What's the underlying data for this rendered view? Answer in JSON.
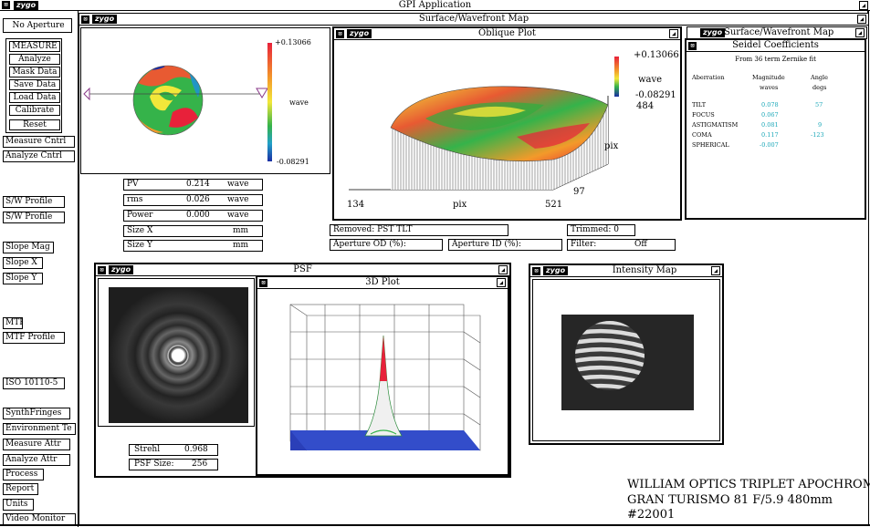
{
  "app": {
    "title": "GPI Application",
    "logo": "zygo"
  },
  "sidebar": {
    "aperture": "No Aperture",
    "menu": [
      "MEASURE",
      "Analyze",
      "Mask Data",
      "Save Data",
      "Load Data",
      "Calibrate",
      "Reset"
    ],
    "buttons": [
      "Measure Cntrl",
      "Analyze Cntrl",
      "S/W Profile",
      "S/W Profile",
      "Slope Mag",
      "Slope X",
      "Slope Y",
      "MTF",
      "MTF Profile",
      "ISO 10110-5",
      "SynthFringes",
      "Environment Te",
      "Measure Attr",
      "Analyze Attr",
      "Process",
      "Report",
      "Units",
      "Video Monitor"
    ]
  },
  "surface_window": {
    "title": "Surface/Wavefront Map",
    "scale_max": "+0.13066",
    "scale_unit": "wave",
    "scale_min": "-0.08291",
    "stats": [
      {
        "label": "PV",
        "value": "0.214",
        "unit": "wave"
      },
      {
        "label": "rms",
        "value": "0.026",
        "unit": "wave"
      },
      {
        "label": "Power",
        "value": "0.000",
        "unit": "wave"
      },
      {
        "label": "Size X",
        "value": "",
        "unit": "mm"
      },
      {
        "label": "Size Y",
        "value": "",
        "unit": "mm"
      }
    ],
    "removed": "Removed: PST TLT",
    "trimmed": "Trimmed:  0",
    "aperture_od": "Aperture OD (%):",
    "aperture_id": "Aperture ID (%):",
    "filter": "Filter:",
    "filter_value": "Off"
  },
  "oblique_plot": {
    "title": "Oblique Plot",
    "scale_max": "+0.13066",
    "scale_unit": "wave",
    "scale_min": "-0.08291",
    "y_max": "484",
    "y_label": "pix",
    "y_min": "97",
    "x_min": "134",
    "x_label": "pix",
    "x_max": "521"
  },
  "seidel": {
    "title_back": "Surface/Wavefront Map",
    "title": "Seidel Coefficients",
    "subtitle": "From 36 term Zernike fit",
    "headers": [
      "Aberration",
      "Magnitude",
      "Angle"
    ],
    "units": [
      "waves",
      "degs"
    ],
    "rows": [
      {
        "name": "TILT",
        "magnitude": "0.078",
        "angle": "57"
      },
      {
        "name": "FOCUS",
        "magnitude": "0.067",
        "angle": ""
      },
      {
        "name": "ASTIGMATISM",
        "magnitude": "0.081",
        "angle": "9"
      },
      {
        "name": "COMA",
        "magnitude": "0.117",
        "angle": "-123"
      },
      {
        "name": "SPHERICAL",
        "magnitude": "-0.007",
        "angle": ""
      }
    ]
  },
  "psf_window": {
    "title": "PSF",
    "plot_title": "3D Plot",
    "strehl_label": "Strehl",
    "strehl_value": "0.968",
    "size_label": "PSF Size:",
    "size_value": "256"
  },
  "intensity_window": {
    "title": "Intensity Map"
  },
  "caption": {
    "line1": "WILLIAM OPTICS TRIPLET APOCHROMAT",
    "line2": "GRAN TURISMO 81 F/5.9 480mm",
    "line3": "#22001"
  },
  "colors": {
    "cyan_value": "#1aa7b8",
    "logo_bg": "#000000"
  },
  "icons": [
    "close-icon",
    "maximize-icon",
    "zygo-logo"
  ]
}
